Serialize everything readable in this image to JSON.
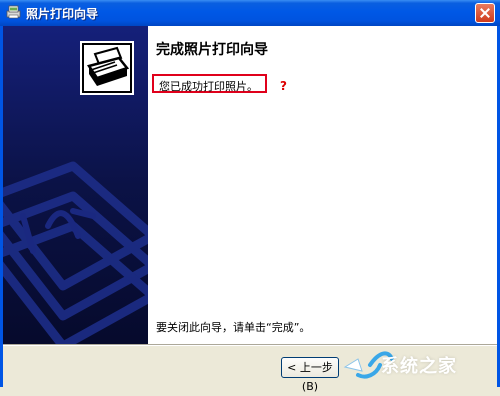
{
  "window": {
    "title": "照片打印向导"
  },
  "content": {
    "heading": "完成照片打印向导",
    "status": "您已成功打印照片。",
    "question_mark": "?",
    "close_hint": "要关闭此向导，请单击“完成”。"
  },
  "buttons": {
    "back_label": "< 上一步(B)"
  },
  "watermark": {
    "text": "系统之家"
  },
  "colors": {
    "titlebar": "#0058e6",
    "side_panel": "#0b1246",
    "highlight_border": "#e0001b"
  },
  "icons": {
    "app": "printer-photo-icon",
    "wizard": "printer-icon",
    "close": "close-icon"
  }
}
